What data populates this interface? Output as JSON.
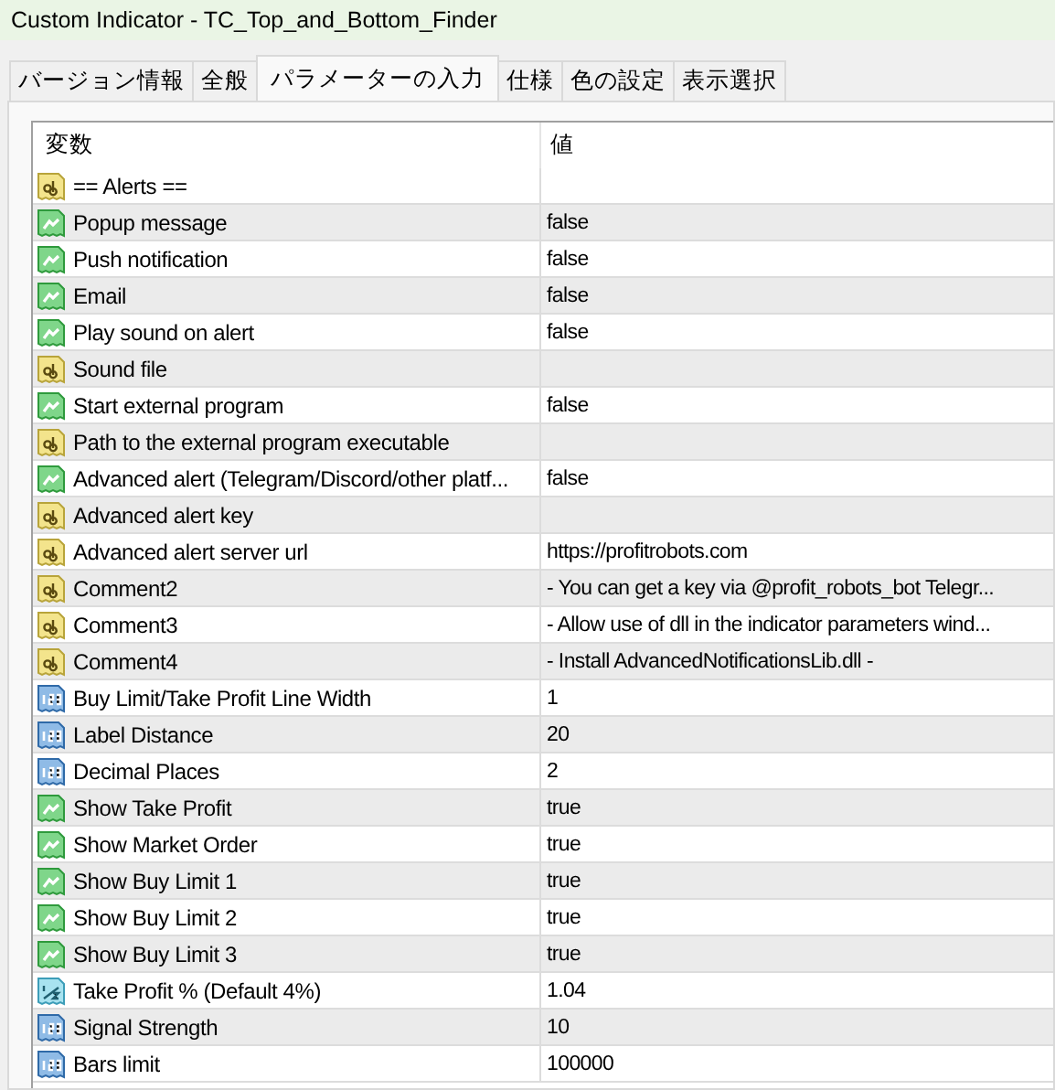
{
  "window": {
    "title": "Custom Indicator - TC_Top_and_Bottom_Finder"
  },
  "tabs": [
    {
      "label": "バージョン情報",
      "selected": false
    },
    {
      "label": "全般",
      "selected": false
    },
    {
      "label": "パラメーターの入力",
      "selected": true
    },
    {
      "label": "仕様",
      "selected": false
    },
    {
      "label": "色の設定",
      "selected": false
    },
    {
      "label": "表示選択",
      "selected": false
    }
  ],
  "table": {
    "columns": [
      "変数",
      "値"
    ],
    "rows": [
      {
        "kind": "string",
        "name": "== Alerts ==",
        "value": ""
      },
      {
        "kind": "bool",
        "name": "Popup message",
        "value": "false"
      },
      {
        "kind": "bool",
        "name": "Push notification",
        "value": "false"
      },
      {
        "kind": "bool",
        "name": "Email",
        "value": "false"
      },
      {
        "kind": "bool",
        "name": "Play sound on alert",
        "value": "false"
      },
      {
        "kind": "string",
        "name": "Sound file",
        "value": ""
      },
      {
        "kind": "bool",
        "name": "Start external program",
        "value": "false"
      },
      {
        "kind": "string",
        "name": "Path to the external program executable",
        "value": ""
      },
      {
        "kind": "bool",
        "name": "Advanced alert (Telegram/Discord/other platf...",
        "value": "false"
      },
      {
        "kind": "string",
        "name": "Advanced alert key",
        "value": ""
      },
      {
        "kind": "string",
        "name": "Advanced alert server url",
        "value": "https://profitrobots.com"
      },
      {
        "kind": "string",
        "name": "Comment2",
        "value": "- You can get a key via @profit_robots_bot Telegr..."
      },
      {
        "kind": "string",
        "name": "Comment3",
        "value": "- Allow use of dll in the indicator parameters wind..."
      },
      {
        "kind": "string",
        "name": "Comment4",
        "value": "- Install AdvancedNotificationsLib.dll -"
      },
      {
        "kind": "int",
        "name": "Buy Limit/Take Profit Line Width",
        "value": "1"
      },
      {
        "kind": "int",
        "name": "Label Distance",
        "value": "20"
      },
      {
        "kind": "int",
        "name": "Decimal Places",
        "value": "2"
      },
      {
        "kind": "bool",
        "name": "Show Take Profit",
        "value": "true"
      },
      {
        "kind": "bool",
        "name": "Show Market Order",
        "value": "true"
      },
      {
        "kind": "bool",
        "name": "Show Buy Limit 1",
        "value": "true"
      },
      {
        "kind": "bool",
        "name": "Show Buy Limit 2",
        "value": "true"
      },
      {
        "kind": "bool",
        "name": "Show Buy Limit 3",
        "value": "true"
      },
      {
        "kind": "double",
        "name": "Take Profit % (Default 4%)",
        "value": "1.04"
      },
      {
        "kind": "int",
        "name": "Signal Strength",
        "value": "10"
      },
      {
        "kind": "int",
        "name": "Bars limit",
        "value": "100000"
      }
    ]
  }
}
